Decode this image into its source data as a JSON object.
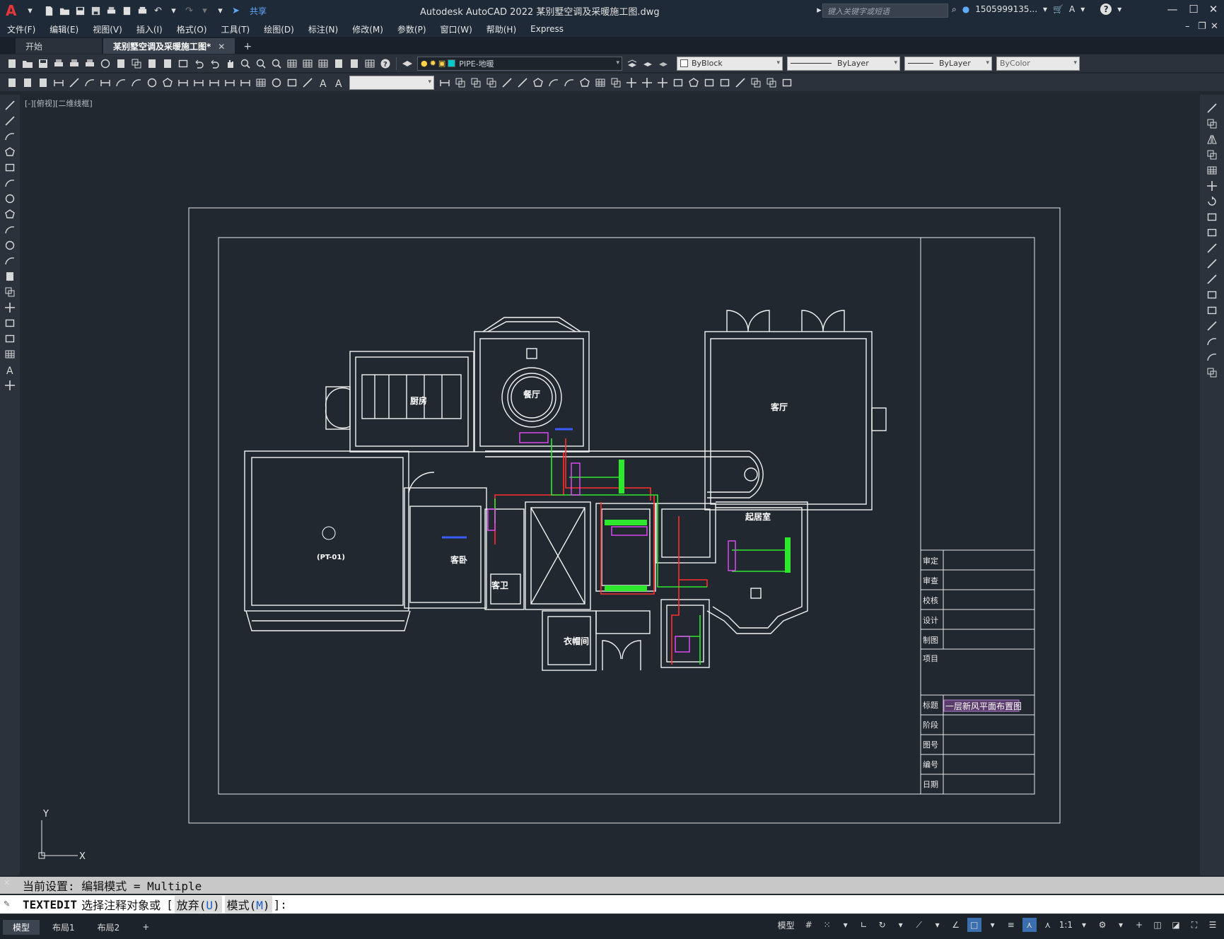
{
  "app": {
    "logo_letter": "A",
    "window_title": "Autodesk AutoCAD 2022    某别墅空调及采暖施工图.dwg",
    "share_label": "共享",
    "search_placeholder": "键入关键字或短语",
    "user": "1505999135...",
    "win_min": "—",
    "win_max": "☐",
    "win_close": "✕"
  },
  "menu": [
    "文件(F)",
    "编辑(E)",
    "视图(V)",
    "插入(I)",
    "格式(O)",
    "工具(T)",
    "绘图(D)",
    "标注(N)",
    "修改(M)",
    "参数(P)",
    "窗口(W)",
    "帮助(H)",
    "Express"
  ],
  "tabs": [
    {
      "label": "开始"
    },
    {
      "label": "某别墅空调及采暖施工图*",
      "close": "✕"
    }
  ],
  "tab_add": "+",
  "toolbar": {
    "layer": "PIPE-地暖",
    "layer_color": "#00c8c8",
    "color": "ByBlock",
    "linetype": "ByLayer",
    "lineweight": "ByLayer",
    "plotstyle": "ByColor"
  },
  "viewport": {
    "label": "[-][俯视][二维线框]"
  },
  "drawing": {
    "rooms": {
      "kitchen": "厨房",
      "dining": "餐厅",
      "living": "客厅",
      "pt": "(PT-01)",
      "guest_room": "客卧",
      "guest_bath": "客卫",
      "closet": "衣帽间",
      "family_room": "起居室"
    },
    "titleblock": {
      "rows": [
        "审定",
        "审查",
        "校核",
        "设计",
        "制图"
      ],
      "project": "项目",
      "title_label": "标题",
      "title_value": "一层新风平面布置图",
      "rows2": [
        "阶段",
        "图号",
        "编号",
        "日期"
      ]
    },
    "ucs": {
      "x": "X",
      "y": "Y"
    }
  },
  "command": {
    "history": "当前设置: 编辑模式 = Multiple",
    "cmd": "TEXTEDIT",
    "prompt": "选择注释对象或",
    "opt1": "放弃(",
    "opt1_key": "U",
    "opt1_end": ")",
    "opt2": "模式(",
    "opt2_key": "M",
    "opt2_end": ")",
    "end": "]:"
  },
  "status": {
    "layouts": [
      "模型",
      "布局1",
      "布局2"
    ],
    "add": "+",
    "model": "模型",
    "scale": "1:1"
  }
}
